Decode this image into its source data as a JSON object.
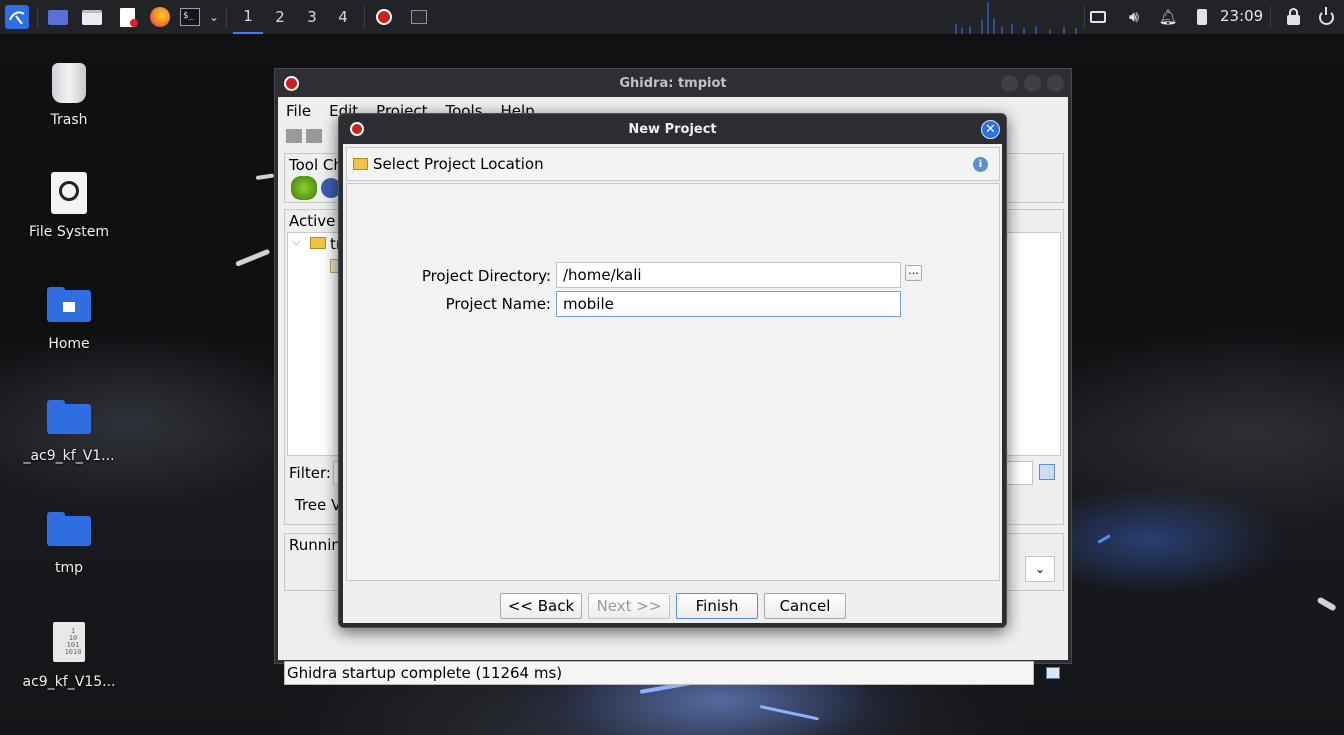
{
  "panel": {
    "workspaces": [
      "1",
      "2",
      "3",
      "4"
    ],
    "active_workspace": "1",
    "clock": "23:09",
    "icons": [
      "kali-menu-icon",
      "desktop-icon",
      "file-manager-icon",
      "text-editor-icon",
      "firefox-icon",
      "terminal-icon",
      "chevron-down-icon",
      "ghidra-icon",
      "terminal-window-icon",
      "display-icon",
      "volume-icon",
      "bell-icon",
      "battery-icon",
      "lock-icon",
      "power-icon"
    ]
  },
  "desktop": {
    "icons": [
      {
        "label": "Trash",
        "icon": "trash-icon"
      },
      {
        "label": "File System",
        "icon": "drive-icon"
      },
      {
        "label": "Home",
        "icon": "home-folder-icon"
      },
      {
        "label": "_ac9_kf_V1...",
        "icon": "folder-icon"
      },
      {
        "label": "tmp",
        "icon": "folder-icon"
      },
      {
        "label": "ac9_kf_V15...",
        "icon": "binary-file-icon"
      }
    ]
  },
  "ghidra": {
    "title": "Ghidra: tmpiot",
    "menu": [
      "File",
      "Edit",
      "Project",
      "Tools",
      "Help"
    ],
    "tool_chest_label": "Tool Ch",
    "active_project_label": "Active P",
    "tree_root": "tr",
    "filter_label": "Filter:",
    "tree_view_tab": "Tree V",
    "running_label": "Running",
    "status": "Ghidra startup complete (11264 ms)"
  },
  "dialog": {
    "title": "New Project",
    "header": "Select Project Location",
    "project_directory_label": "Project Directory:",
    "project_directory_value": "/home/kali",
    "browse_label": "...",
    "project_name_label": "Project Name:",
    "project_name_value": "mobile",
    "back_label": "<< Back",
    "next_label": "Next >>",
    "finish_label": "Finish",
    "cancel_label": "Cancel"
  },
  "colors": {
    "panel_bg": "#212327",
    "accent": "#3e7bff",
    "dialog_bg": "#2b2d31",
    "close_button": "#2f6ee0"
  }
}
